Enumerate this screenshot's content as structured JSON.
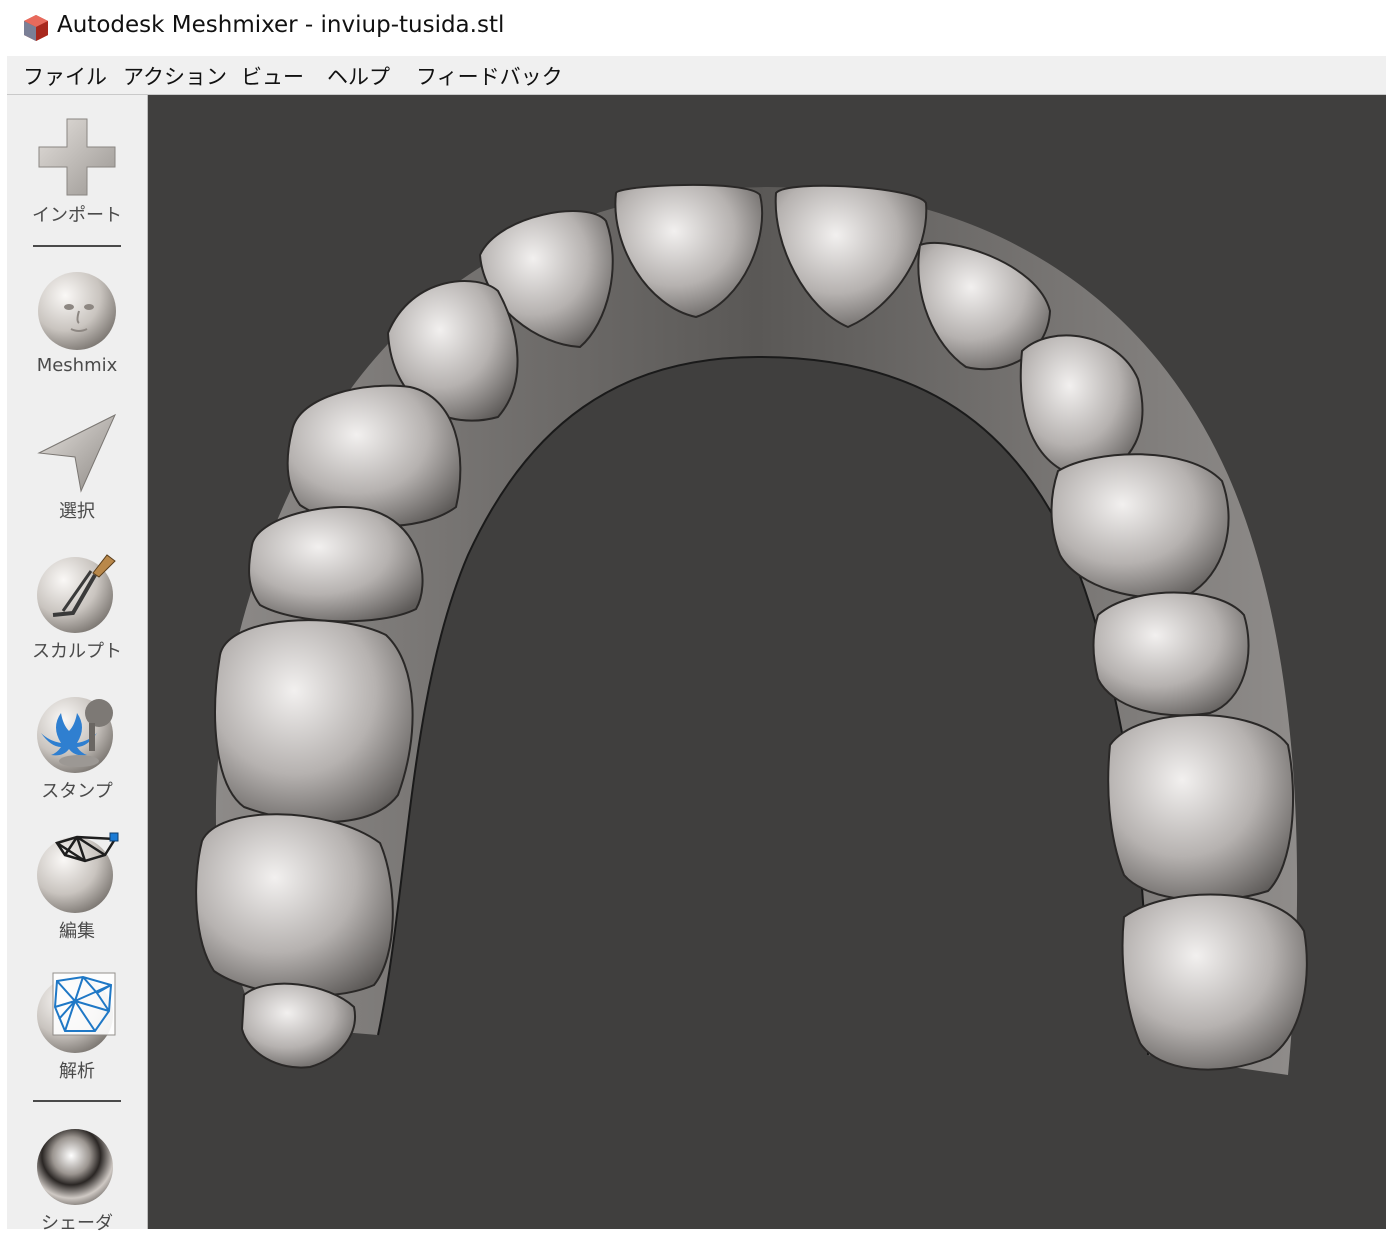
{
  "window": {
    "title": "Autodesk Meshmixer - inviup-tusida.stl",
    "app_icon": "meshmixer-cube-icon"
  },
  "menubar": {
    "items": [
      {
        "label": "ファイル"
      },
      {
        "label": "アクション"
      },
      {
        "label": "ビュー"
      },
      {
        "label": "ヘルプ"
      },
      {
        "label": "フィードバック"
      }
    ]
  },
  "toolbar": {
    "tools": [
      {
        "label": "インポート",
        "icon": "plus-icon"
      },
      {
        "label": "Meshmix",
        "icon": "face-sphere-icon"
      },
      {
        "label": "選択",
        "icon": "arrow-cursor-icon"
      },
      {
        "label": "スカルプト",
        "icon": "brush-sphere-icon"
      },
      {
        "label": "スタンプ",
        "icon": "stamp-sphere-icon"
      },
      {
        "label": "編集",
        "icon": "edit-mesh-icon"
      },
      {
        "label": "解析",
        "icon": "analysis-mesh-icon"
      },
      {
        "label": "シェーダ",
        "icon": "chrome-sphere-icon"
      }
    ]
  },
  "viewport": {
    "background": "#403f3e",
    "model": "dental-arch-mesh"
  }
}
